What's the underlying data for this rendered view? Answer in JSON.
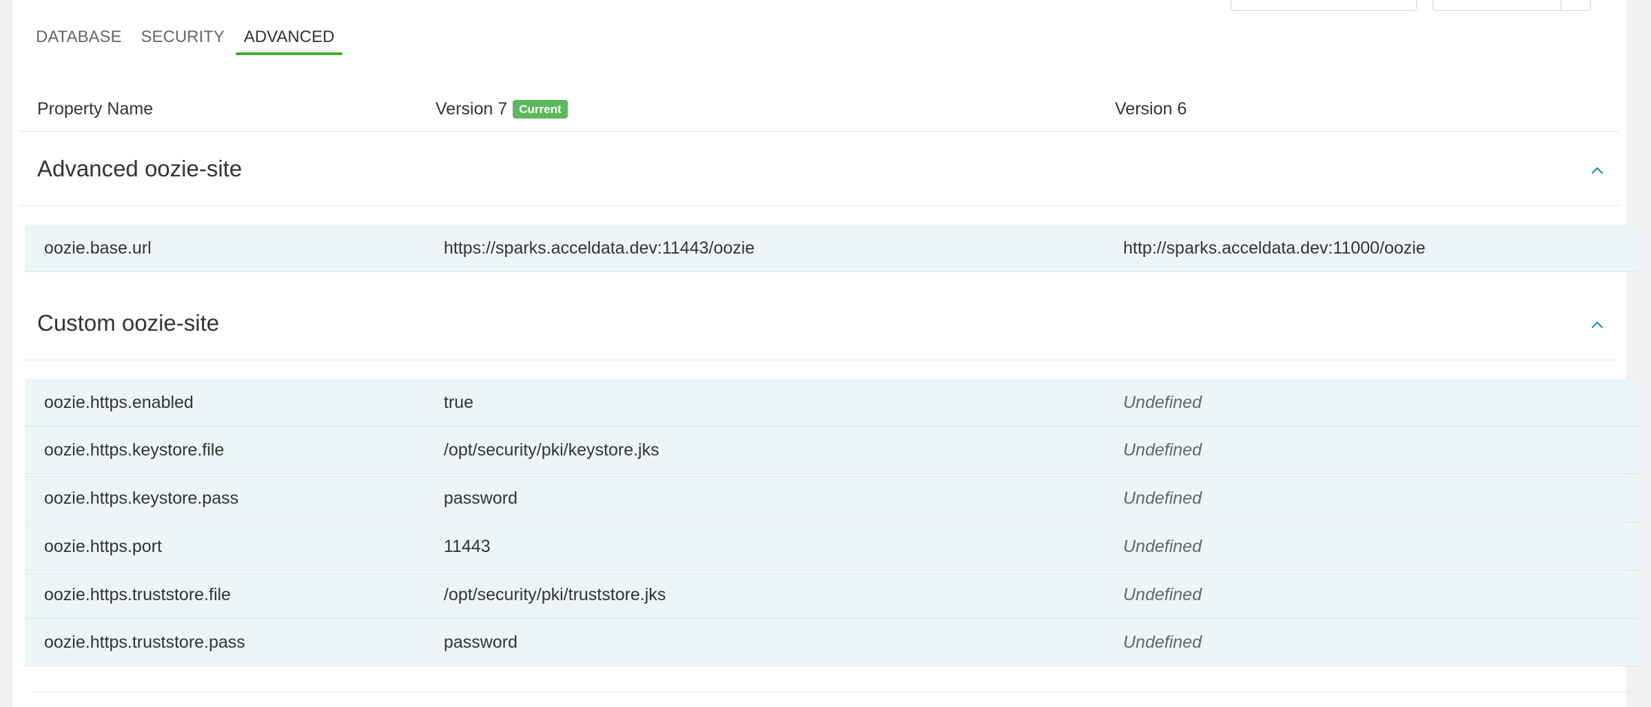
{
  "tabs": [
    {
      "label": "DATABASE",
      "active": false
    },
    {
      "label": "SECURITY",
      "active": false
    },
    {
      "label": "ADVANCED",
      "active": true
    }
  ],
  "columns": {
    "property_name": "Property Name",
    "version7": "Version 7",
    "current_badge": "Current",
    "version6": "Version 6"
  },
  "sections": [
    {
      "title": "Advanced oozie-site",
      "rows": [
        {
          "name": "oozie.base.url",
          "v7": "https://sparks.acceldata.dev:11443/oozie",
          "v6": "http://sparks.acceldata.dev:11000/oozie"
        }
      ]
    },
    {
      "title": "Custom oozie-site",
      "rows": [
        {
          "name": "oozie.https.enabled",
          "v7": "true",
          "v6": "Undefined"
        },
        {
          "name": "oozie.https.keystore.file",
          "v7": "/opt/security/pki/keystore.jks",
          "v6": "Undefined"
        },
        {
          "name": "oozie.https.keystore.pass",
          "v7": "password",
          "v6": "Undefined"
        },
        {
          "name": "oozie.https.port",
          "v7": "11443",
          "v6": "Undefined"
        },
        {
          "name": "oozie.https.truststore.file",
          "v7": "/opt/security/pki/truststore.jks",
          "v6": "Undefined"
        },
        {
          "name": "oozie.https.truststore.pass",
          "v7": "password",
          "v6": "Undefined"
        }
      ]
    }
  ],
  "icons": {
    "collapse": "chevron-up-icon"
  },
  "colors": {
    "accent_green": "#3fae2a",
    "badge_green": "#5cb85c",
    "chevron_blue": "#1b8fb5",
    "row_bg": "#eef5f8"
  }
}
